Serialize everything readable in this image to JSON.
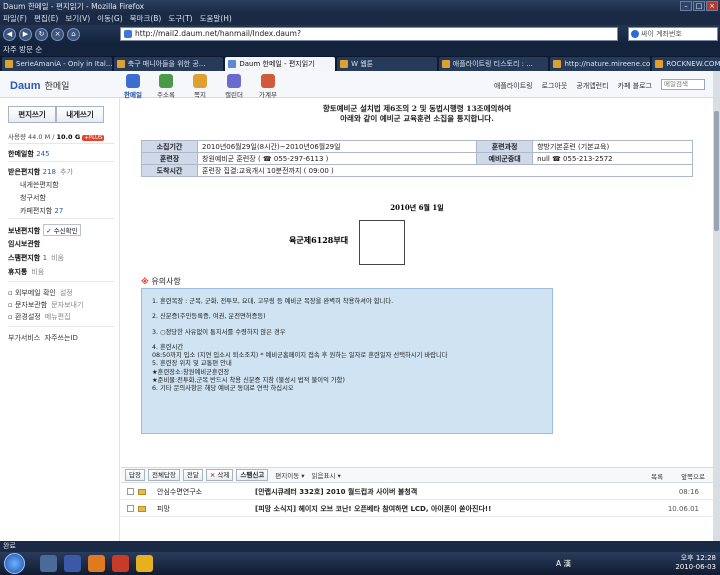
{
  "browser": {
    "title": "Daum 한메일 - 편지읽기 - Mozilla Firefox",
    "menu": [
      "파일(F)",
      "편집(E)",
      "보기(V)",
      "이동(G)",
      "북마크(B)",
      "도구(T)",
      "도움말(H)"
    ],
    "url": "http://mail2.daum.net/hanmail/Index.daum?",
    "search_placeholder": "싸이 계좌번호",
    "bookmark": "자주 방문 순",
    "tabs": [
      "SerieAmaniA - Only in Ital...",
      "축구 매니아들을 위한 공...",
      "Daum 한메일 - 편지읽기",
      "W 웹툰",
      "애플라이트링 티스토리 : ...",
      "http://nature.mireene.com/...",
      "ROCKNEW.COM l..."
    ],
    "status": "완료"
  },
  "daum": {
    "logo": "Daum",
    "logo_sub": "한메일",
    "apps": [
      "한메일",
      "주소록",
      "쪽지",
      "캘린더",
      "가계부"
    ],
    "links": [
      "애플라이트링",
      "로그아웃",
      "공개앱런티",
      "카페 블로그"
    ],
    "search_placeholder": "메일검색"
  },
  "sidebar": {
    "write": "편지쓰기",
    "self_write": "내게쓰기",
    "quota_label": "사용량",
    "quota_used": "44.0 M",
    "quota_total": "10.0 G",
    "quota_plus": "+PLUS",
    "hanmail": "한메일함",
    "hanmail_count": "245",
    "inbox": "받은편지함",
    "inbox_count": "218",
    "inbox_sub": "추가",
    "inbox_items": [
      "내게쓴편지함",
      "청구서함"
    ],
    "cafe": "카페편지함",
    "cafe_count": "27",
    "sent": "보낸편지함",
    "sent_check": "수신확인",
    "temp": "임시보관함",
    "spam": "스팸편지함",
    "spam_count": "1",
    "spam_sub": "비움",
    "trash": "휴지통",
    "trash_sub": "비움",
    "outer": "외부메일 확인",
    "outer_sub": "설정",
    "storage": "문자보관함",
    "storage_sub": "문자보내기",
    "settings": "환경설정",
    "settings_sub": "메뉴편집",
    "extra": "부가서비스",
    "extra2": "자주쓰는ID"
  },
  "mail": {
    "subject_line1": "향토예비군 설치법 제6조의 2 및 동법시행령 13조에의하여",
    "subject_line2": "아래와 같이 예비군 교육훈련 소집을 통지합니다.",
    "rows": [
      {
        "h1": "소집기간",
        "v1": "2010년06월29일(8시간)~2010년06월29일",
        "h2": "훈련과정",
        "v2": "향방기본훈련 (기본교육)"
      },
      {
        "h1": "훈련장",
        "v1": "창원예비군 훈련장 ( ☎ 055-297-6113 )",
        "h2": "예비군중대",
        "v2": "null ☎ 055-213-2572"
      },
      {
        "h1": "도착시간",
        "v1": "훈련장 집결:교육개시 10분전까지 ( 09:00 )",
        "h2": "",
        "v2": ""
      }
    ],
    "date": "2010년 6월 1일",
    "unit": "육군제6128부대",
    "notice_mark": "※",
    "notice_title": "유의사항",
    "notes": [
      "1. 훈련복장 : 군복, 군화, 전투모, 요대, 고무링 등 예비군 복장을 완벽히 착용하셔야 합니다.",
      "2. 신분증(주민등록증, 여권, 운전면허증등)",
      "3. ○정당한 사유없이 통지서를 수령하지 않은 경우",
      "4. 훈련시간",
      "08:50까지 입소 (지연 입소시 퇴소조치) * 예비군홈페이지 접속 후 원하는 일자로 훈련일자 선택하시기 바랍니다",
      "5. 훈련장 위치 및 교통편 안내",
      "★훈련장소:창원예비군훈련장",
      "★준비물:전투화,군복 반드시 착용 신분증 지참 (불성시 법적 불이익 가함)",
      "6. 기타 문의사항은 해당 예비군 동대로 연락 하십시오"
    ]
  },
  "actions": {
    "reply": "답장",
    "reply_all": "전체답장",
    "forward": "전달",
    "delete_mark": "×",
    "delete": "삭제",
    "spam": "스팸신고",
    "move": "편지이동",
    "read": "읽음표시",
    "list": "목록",
    "prev": "앞쪽으로"
  },
  "list": [
    {
      "from": "안심수면연구소",
      "subject": "[안랩시큐레터 332호] 2010 월드컵과 사이버 불청객",
      "date": "08:16"
    },
    {
      "from": "피망",
      "subject": "[피망 소식지] 헤이지 오브 코난! 오픈베타 참여하면 LCD, 아이폰이 쏟아진다!!",
      "date": "10.06.01"
    }
  ],
  "taskbar": {
    "lang": "A 漢",
    "time": "오후 12:28",
    "date": "2010-06-03"
  }
}
